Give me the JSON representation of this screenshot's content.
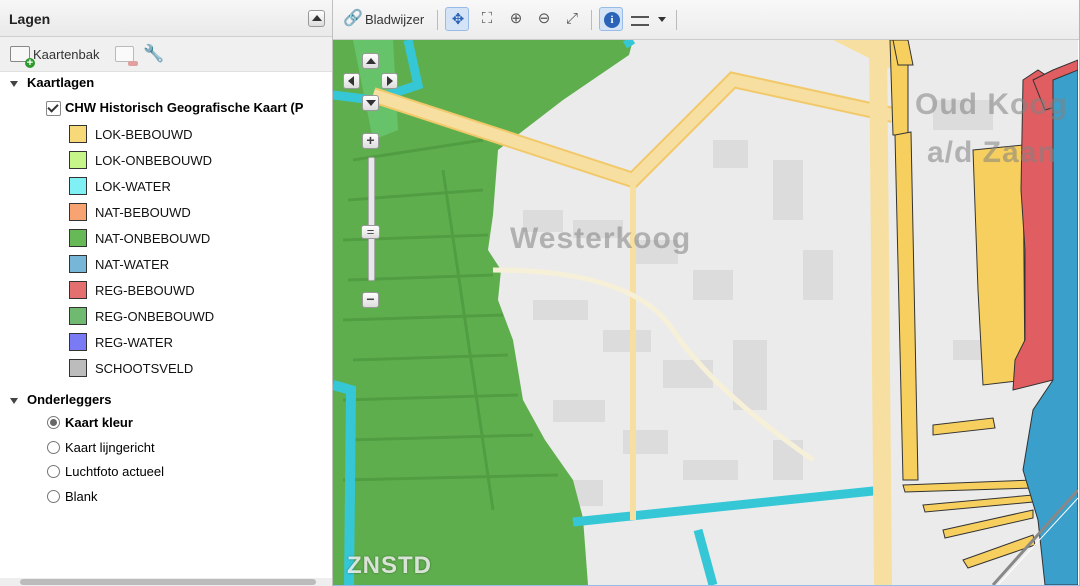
{
  "panel": {
    "title": "Lagen",
    "toolbar": {
      "add_label": "Kaartenbak"
    },
    "kaartlagen": {
      "heading": "Kaartlagen",
      "layer": {
        "title": "CHW Historisch Geografische Kaart (P",
        "checked": true
      },
      "legend": [
        {
          "label": "LOK-BEBOUWD",
          "color": "#f8d97a"
        },
        {
          "label": "LOK-ONBEBOUWD",
          "color": "#c6f58a"
        },
        {
          "label": "LOK-WATER",
          "color": "#7ff0f4"
        },
        {
          "label": "NAT-BEBOUWD",
          "color": "#f7a472"
        },
        {
          "label": "NAT-ONBEBOUWD",
          "color": "#67b857"
        },
        {
          "label": "NAT-WATER",
          "color": "#78b6d8"
        },
        {
          "label": "REG-BEBOUWD",
          "color": "#e46f6f"
        },
        {
          "label": "REG-ONBEBOUWD",
          "color": "#6fba70"
        },
        {
          "label": "REG-WATER",
          "color": "#7a7af4"
        },
        {
          "label": "SCHOOTSVELD",
          "color": "#bcbcbc"
        }
      ]
    },
    "onderleggers": {
      "heading": "Onderleggers",
      "options": [
        {
          "label": "Kaart kleur",
          "selected": true
        },
        {
          "label": "Kaart lijngericht",
          "selected": false
        },
        {
          "label": "Luchtfoto actueel",
          "selected": false
        },
        {
          "label": "Blank",
          "selected": false
        }
      ]
    }
  },
  "map_toolbar": {
    "bookmark_label": "Bladwijzer",
    "tools": [
      "pan-icon",
      "zoom-box-icon",
      "zoom-in-icon",
      "zoom-out-icon",
      "zoom-extent-icon",
      "info-icon",
      "measure-icon"
    ],
    "active_tools": [
      "pan-icon",
      "info-icon"
    ]
  },
  "map": {
    "place_labels": [
      "Westerkoog",
      "Oud Koog",
      "a/d Zaan"
    ],
    "logo": "ZNSTD",
    "colors": {
      "nat_onbebouwd": "#5fae4e",
      "lok_water": "#35c7d6",
      "lok_bebouwd": "#f6cf5e",
      "reg_bebouwd": "#e05d62",
      "nat_water": "#3a9fcb",
      "road": "#f6dfa0"
    }
  }
}
